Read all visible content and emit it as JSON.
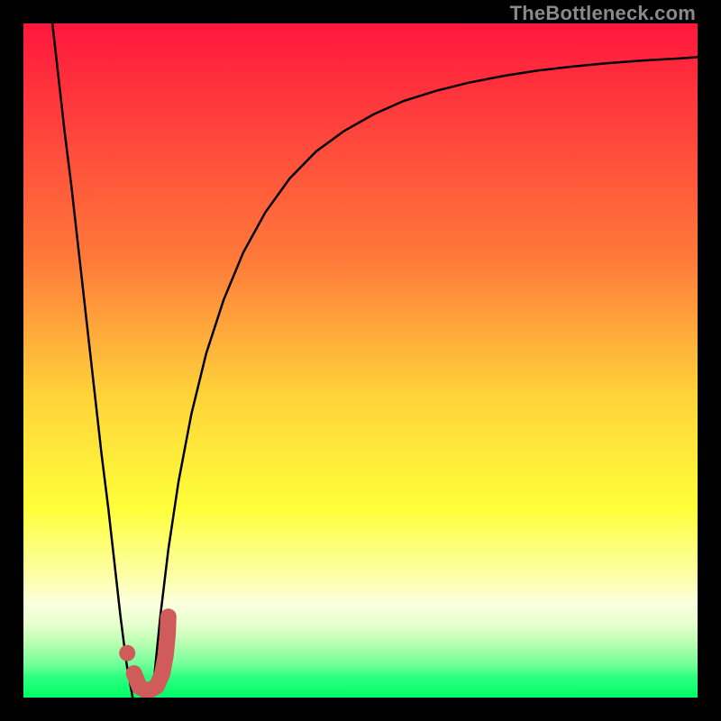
{
  "watermark": "TheBottleneck.com",
  "chart_data": {
    "type": "line",
    "title": "",
    "xlabel": "",
    "ylabel": "",
    "xlim": [
      0,
      100
    ],
    "ylim": [
      0,
      100
    ],
    "grid": false,
    "legend": false,
    "gradient_stops": [
      {
        "offset": 0,
        "color": "#ff173d"
      },
      {
        "offset": 35,
        "color": "#ff7a3a"
      },
      {
        "offset": 55,
        "color": "#ffd23a"
      },
      {
        "offset": 72,
        "color": "#ffff3a"
      },
      {
        "offset": 82,
        "color": "#fcffa8"
      },
      {
        "offset": 86,
        "color": "#fbffdd"
      },
      {
        "offset": 89,
        "color": "#e8ffd0"
      },
      {
        "offset": 92,
        "color": "#b8ffb0"
      },
      {
        "offset": 95,
        "color": "#75ff9a"
      },
      {
        "offset": 97,
        "color": "#2bff80"
      },
      {
        "offset": 100,
        "color": "#00ff66"
      }
    ],
    "series": [
      {
        "name": "left-branch",
        "color": "#000000",
        "width": 2.5,
        "x": [
          4.3,
          5.2,
          6.1,
          7.1,
          8.0,
          8.9,
          9.8,
          10.7,
          11.6,
          12.6,
          13.5,
          14.4,
          15.3,
          16.2
        ],
        "values": [
          100,
          92,
          84,
          76,
          68,
          60,
          52,
          44,
          36,
          28,
          20,
          12,
          5,
          0
        ]
      },
      {
        "name": "right-branch",
        "color": "#000000",
        "width": 2.5,
        "x": [
          19.1,
          19.6,
          20.3,
          21.5,
          23.0,
          24.9,
          27.1,
          29.7,
          32.6,
          35.9,
          39.5,
          43.4,
          47.5,
          51.9,
          56.4,
          61.2,
          66.0,
          71.1,
          76.2,
          81.4,
          86.6,
          91.9,
          97.2,
          100.0
        ],
        "values": [
          0,
          5,
          12,
          22,
          32,
          42,
          51,
          59,
          66,
          72,
          77,
          81,
          84,
          86.5,
          88.5,
          90,
          91.2,
          92.2,
          93,
          93.6,
          94.1,
          94.5,
          94.8,
          95
        ]
      },
      {
        "name": "j-marker-stroke",
        "color": "#cf5b5b",
        "width": 18,
        "x": [
          16.4,
          17.2,
          18.4,
          19.8,
          20.6,
          21.1,
          21.4,
          21.5
        ],
        "values": [
          3.6,
          1.6,
          0.9,
          1.7,
          3.6,
          6.3,
          9.4,
          12.0
        ]
      }
    ],
    "markers": [
      {
        "name": "j-marker-dot",
        "x": 15.4,
        "y": 6.6,
        "r": 9,
        "color": "#cf5b5b"
      }
    ]
  }
}
